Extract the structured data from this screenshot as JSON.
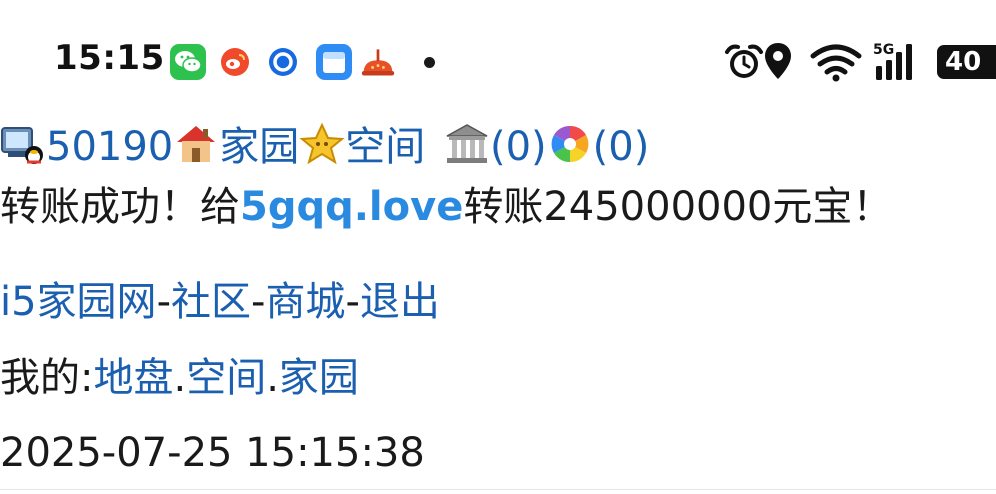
{
  "status_bar": {
    "time": "15:15",
    "network_type": "5G",
    "battery": "40"
  },
  "nav": {
    "user_id": "50190",
    "home_label": "家园",
    "space_label": "空间",
    "bank_count": "(0)",
    "album_count": "(0)"
  },
  "message": {
    "prefix": "转账成功！给",
    "recipient": "5gqq.love",
    "suffix": "转账245000000元宝！"
  },
  "links": {
    "site": "i5家园网",
    "community": "社区",
    "mall": "商城",
    "logout": "退出",
    "separator": "-"
  },
  "mine": {
    "label": "我的:",
    "land": "地盘",
    "space": "空间",
    "home": "家园",
    "dot": "."
  },
  "timestamp": "2025-07-25 15:15:38"
}
